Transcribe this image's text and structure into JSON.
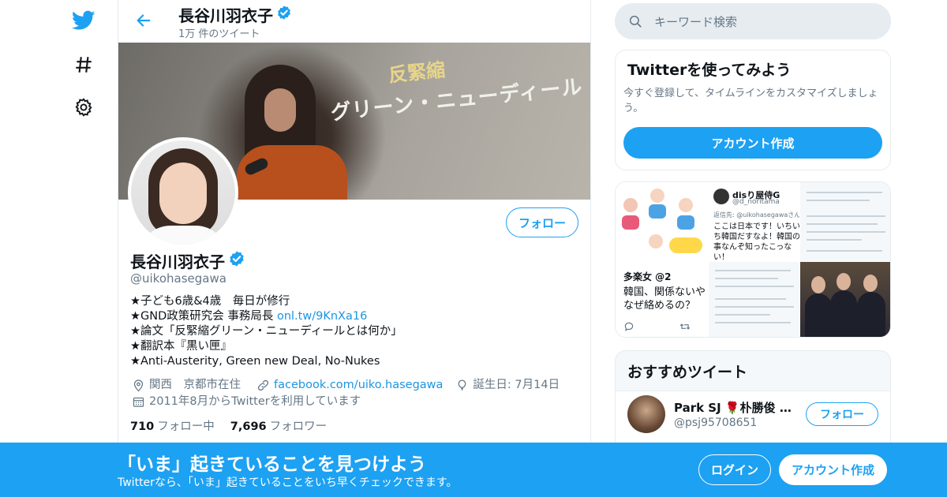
{
  "nav": {
    "icons": [
      "twitter-logo-icon",
      "hashtag-icon",
      "gear-icon"
    ]
  },
  "header": {
    "name": "長谷川羽衣子",
    "tweet_count": "1万 件のツイート"
  },
  "banner": {
    "line1": "反緊縮",
    "line2": "グリーン・ニューディール"
  },
  "profile": {
    "follow_label": "フォロー",
    "name": "長谷川羽衣子",
    "handle": "@uikohasegawa",
    "bio": {
      "line1": "★子ども6歳&4歳　毎日が修行",
      "line2_text": "★GND政策研究会 事務局長 ",
      "line2_link": "onl.tw/9KnXa16",
      "line3": "★論文「反緊縮グリーン・ニューディールとは何か」",
      "line4": "★翻訳本『黒い匣』",
      "line5": "★Anti-Austerity, Green new Deal, No-Nukes"
    },
    "location": "関西　京都市在住",
    "website": "facebook.com/uiko.hasegawa",
    "birthday": "誕生日: 7月14日",
    "joined": "2011年8月からTwitterを利用しています",
    "following_count": "710",
    "following_label": "フォロー中",
    "followers_count": "7,696",
    "followers_label": "フォロワー"
  },
  "search": {
    "placeholder": "キーワード検索"
  },
  "try_card": {
    "title": "Twitterを使ってみよう",
    "desc": "今すぐ登録して、タイムラインをカスタマイズしましょう。",
    "button": "アカウント作成"
  },
  "media": {
    "m2_name": "disり屋侍G",
    "m2_handle": "@d_noritama",
    "m2_reply": "返信先: @uikohasegawaさん",
    "m2_text": "ここは日本です！いちいち韓国だすなよ！韓国の事なんぞ知ったこっない！",
    "m4_name": "多楽女 @2",
    "m4_text": "韓国、関係ないやなぜ絡めるの？"
  },
  "recs": {
    "title": "おすすめツイート",
    "name": "Park SJ 🌹朴勝俊 A...",
    "handle": "@psj95708651",
    "button": "フォロー"
  },
  "bottom": {
    "title": "「いま」起きていることを見つけよう",
    "subtitle": "Twitterなら、「いま」起きていることをいち早くチェックできます。",
    "login": "ログイン",
    "signup": "アカウント作成"
  },
  "colors": {
    "accent": "#1da1f2",
    "muted": "#657786",
    "link": "#1b95e0"
  }
}
